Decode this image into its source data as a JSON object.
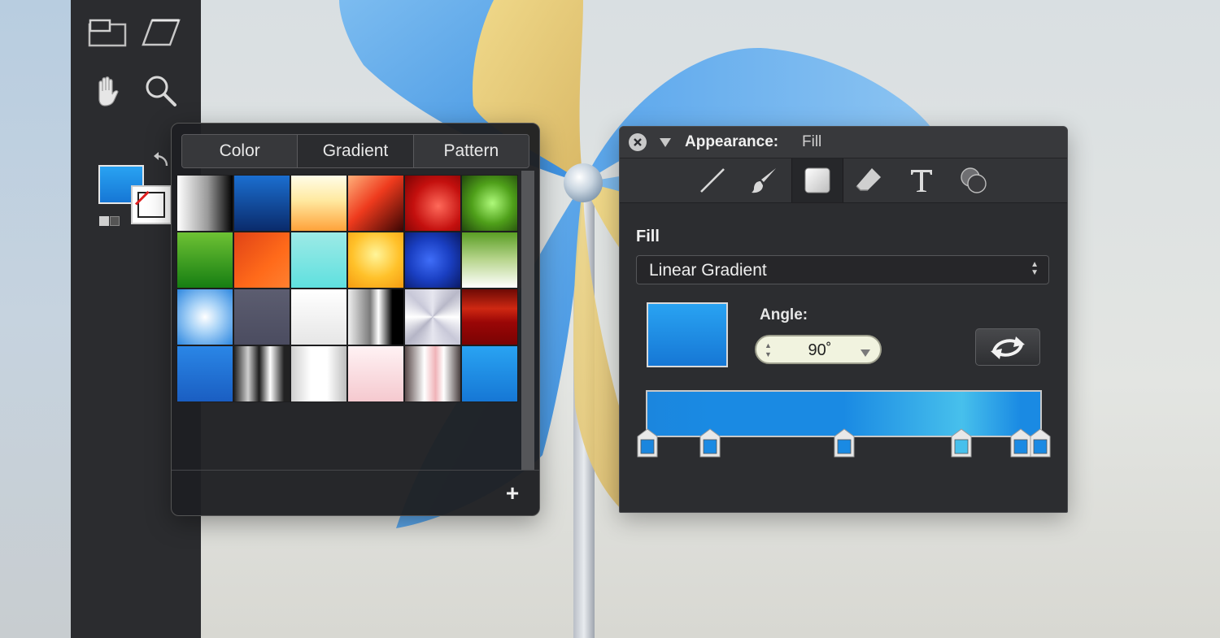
{
  "toolbar": {
    "tools": [
      {
        "name": "frame-tool-icon"
      },
      {
        "name": "skew-tool-icon"
      },
      {
        "name": "hand-tool-icon"
      },
      {
        "name": "zoom-tool-icon"
      }
    ],
    "fill_color": "#1a8ae3",
    "stroke_color": "#ffffff"
  },
  "swatch_popover": {
    "tabs": [
      {
        "label": "Color",
        "active": false
      },
      {
        "label": "Gradient",
        "active": true
      },
      {
        "label": "Pattern",
        "active": false
      }
    ],
    "add_label": "+",
    "swatches": [
      "linear-gradient(90deg,#ffffff,#9a9a9a 55%,#000000)",
      "linear-gradient(180deg,#1b6fd0,#0a2b6b)",
      "linear-gradient(180deg,#fffde8,#ffe9a0 45%,#ffa23a)",
      "linear-gradient(135deg,#ffb07a,#ee3a1d 45%,#3b0503)",
      "radial-gradient(circle at 60% 55%,#ff6a5a,#c4100e 55%,#7c0303)",
      "radial-gradient(circle at 55% 50%,#aef97a,#4fa01a 50%,#21460c)",
      "linear-gradient(180deg,#6ec234,#167e12)",
      "linear-gradient(135deg,#e04316,#ff6a1a 60%,#ff8030)",
      "linear-gradient(180deg,#9deae6,#5fe0df)",
      "radial-gradient(circle at 50% 40%,#fff59a,#ffc12a 55%,#f59b10)",
      "radial-gradient(circle at 45% 50%,#3f6df8,#1a3fc2 50%,#0a1a66)",
      "linear-gradient(180deg,#5a9e24,#b9d68f 50%,#ffffff)",
      "radial-gradient(circle at 50% 50%,#ffffff,#a9d3f7 40%,#2d87e0)",
      "linear-gradient(180deg,#5c5d70,#4b4c60)",
      "linear-gradient(180deg,#ffffff,#e6e6e6)",
      "linear-gradient(90deg,#eeeeee,#7a7a7a 40%,#ffffff 55%,#000000 80%)",
      "conic-gradient(from 0deg,#e6e6ef,#b8b8c8,#ffffff,#c8c8d8,#e6e6ef,#b5b5c6,#ffffff,#c8c8d8,#e6e6ef)",
      "linear-gradient(180deg,#6e0a05,#ce2812 35%,#9a0606 60%,#7a0303)",
      "linear-gradient(180deg,#2a86e6,#1a5ec2)",
      "linear-gradient(90deg,#222,#cfcfcf 25%,#1a1a1a 45%,#ffffff 65%,#222 90%)",
      "linear-gradient(90deg,#cfcfcf,#ffffff 35%,#ffffff 65%,#bdbdbd)",
      "linear-gradient(180deg,#fff2f4,#f5c9cf)",
      "linear-gradient(90deg,#5a4a4a,#ffffff 35%,#f0b3b8 55%,#ffffff 70%,#4a4040)",
      "linear-gradient(180deg,#29a3f2,#1677d5)"
    ]
  },
  "appearance_panel": {
    "title_label": "Appearance:",
    "title_value": "Fill",
    "tabs": [
      {
        "name": "stroke-tab-icon"
      },
      {
        "name": "brush-tab-icon"
      },
      {
        "name": "fill-tab-icon"
      },
      {
        "name": "eraser-tab-icon"
      },
      {
        "name": "text-tab-icon"
      },
      {
        "name": "effects-tab-icon"
      }
    ],
    "section_label": "Fill",
    "fill_type": "Linear Gradient",
    "angle_label": "Angle:",
    "angle_value": "90˚",
    "gradient_stops": [
      {
        "position": 0.0,
        "color": "#1b86de"
      },
      {
        "position": 0.16,
        "color": "#1a8ae3"
      },
      {
        "position": 0.5,
        "color": "#1a8ae3"
      },
      {
        "position": 0.8,
        "color": "#47c0ec"
      },
      {
        "position": 0.95,
        "color": "#1a8ae3"
      },
      {
        "position": 1.0,
        "color": "#1a8ae3"
      }
    ]
  }
}
